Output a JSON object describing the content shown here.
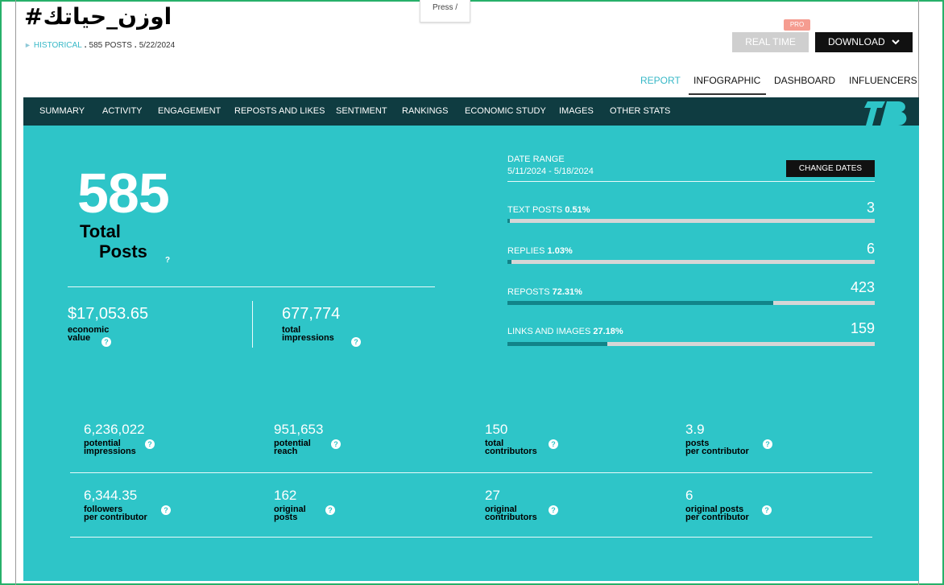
{
  "header": {
    "title": "#اوزن_حياتك",
    "historical": "HISTORICAL",
    "posts": "585 POSTS",
    "date": "5/22/2024",
    "press": "Press /",
    "pro_badge": "PRO",
    "realtime_label": "REAL TIME",
    "download_label": "DOWNLOAD"
  },
  "top_nav": [
    "REPORT",
    "INFOGRAPHIC",
    "DASHBOARD",
    "INFLUENCERS"
  ],
  "sub_nav": [
    "SUMMARY",
    "ACTIVITY",
    "ENGAGEMENT",
    "REPOSTS AND LIKES",
    "SENTIMENT",
    "RANKINGS",
    "ECONOMIC STUDY",
    "IMAGES",
    "OTHER STATS"
  ],
  "summary": {
    "total_posts": "585",
    "total_l1": "Total",
    "total_l2": "Posts",
    "economic_value": "$17,053.65",
    "economic_l1": "economic",
    "economic_l2": "value",
    "impressions": "677,774",
    "impressions_l1": "total",
    "impressions_l2": "impressions"
  },
  "date_range": {
    "label": "DATE RANGE",
    "value": "5/11/2024 - 5/18/2024",
    "change_label": "CHANGE DATES"
  },
  "breakdown": [
    {
      "label": "TEXT POSTS",
      "pct": "0.51%",
      "count": "3",
      "fraction": 0.0051
    },
    {
      "label": "REPLIES",
      "pct": "1.03%",
      "count": "6",
      "fraction": 0.0103
    },
    {
      "label": "REPOSTS",
      "pct": "72.31%",
      "count": "423",
      "fraction": 0.7231
    },
    {
      "label": "LINKS AND IMAGES",
      "pct": "27.18%",
      "count": "159",
      "fraction": 0.2718
    }
  ],
  "stats": [
    {
      "value": "6,236,022",
      "l1": "potential",
      "l2": "impressions"
    },
    {
      "value": "951,653",
      "l1": "potential",
      "l2": "reach"
    },
    {
      "value": "150",
      "l1": "total",
      "l2": "contributors"
    },
    {
      "value": "3.9",
      "l1": "posts",
      "l2": "per contributor"
    },
    {
      "value": "6,344.35",
      "l1": "followers",
      "l2": "per contributor"
    },
    {
      "value": "162",
      "l1": "original",
      "l2": "posts"
    },
    {
      "value": "27",
      "l1": "original",
      "l2": "contributors"
    },
    {
      "value": "6",
      "l1": "original posts",
      "l2": "per contributor"
    }
  ],
  "colors": {
    "panel": "#2ec5c8",
    "subnav": "#0f3c41",
    "accent": "#37b8c7",
    "bar_fill": "#118489"
  }
}
